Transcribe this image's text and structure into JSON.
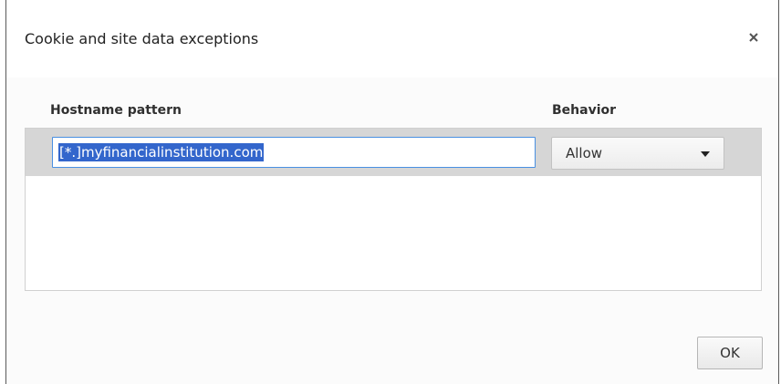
{
  "dialog": {
    "title": "Cookie and site data exceptions",
    "close_icon": "close-icon"
  },
  "table": {
    "columns": {
      "hostname": "Hostname pattern",
      "behavior": "Behavior"
    },
    "rows": [
      {
        "hostname_value": "[*.]myfinancialinstitution.com",
        "behavior": "Allow"
      }
    ]
  },
  "footer": {
    "ok_label": "OK"
  },
  "colors": {
    "selection": "#3366cc",
    "focus_border": "#4a90e2",
    "row_selected_bg": "#d6d6d6"
  }
}
